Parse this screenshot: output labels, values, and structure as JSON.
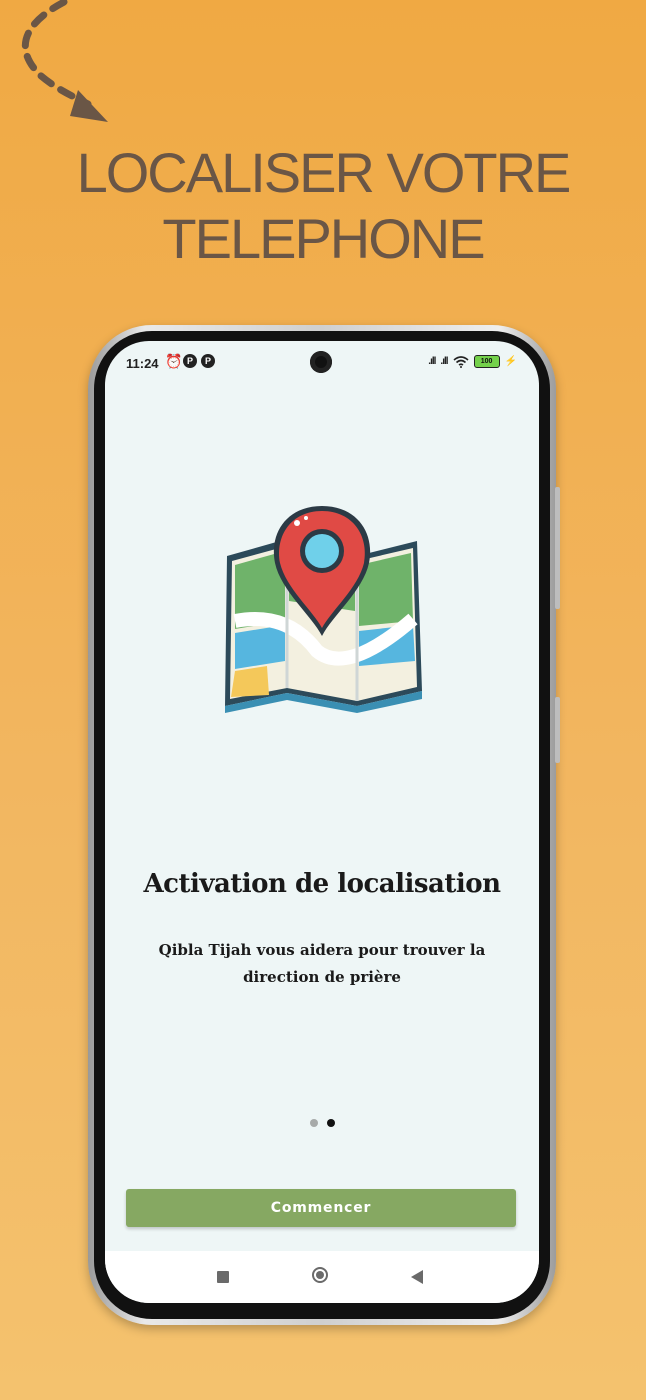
{
  "headline": {
    "line1": "LOCALISER VOTRE",
    "line2": "TELEPHONE"
  },
  "status_bar": {
    "time": "11:24",
    "battery": "100"
  },
  "onboarding": {
    "title": "Activation de localisation",
    "subtitle": "Qibla Tijah vous aidera pour trouver la direction de prière",
    "page_index": 2,
    "page_count": 2,
    "button_label": "Commencer"
  },
  "colors": {
    "background": "#f0a943",
    "headline": "#6a5646",
    "button": "#86a862",
    "screen": "#eef6f6"
  }
}
